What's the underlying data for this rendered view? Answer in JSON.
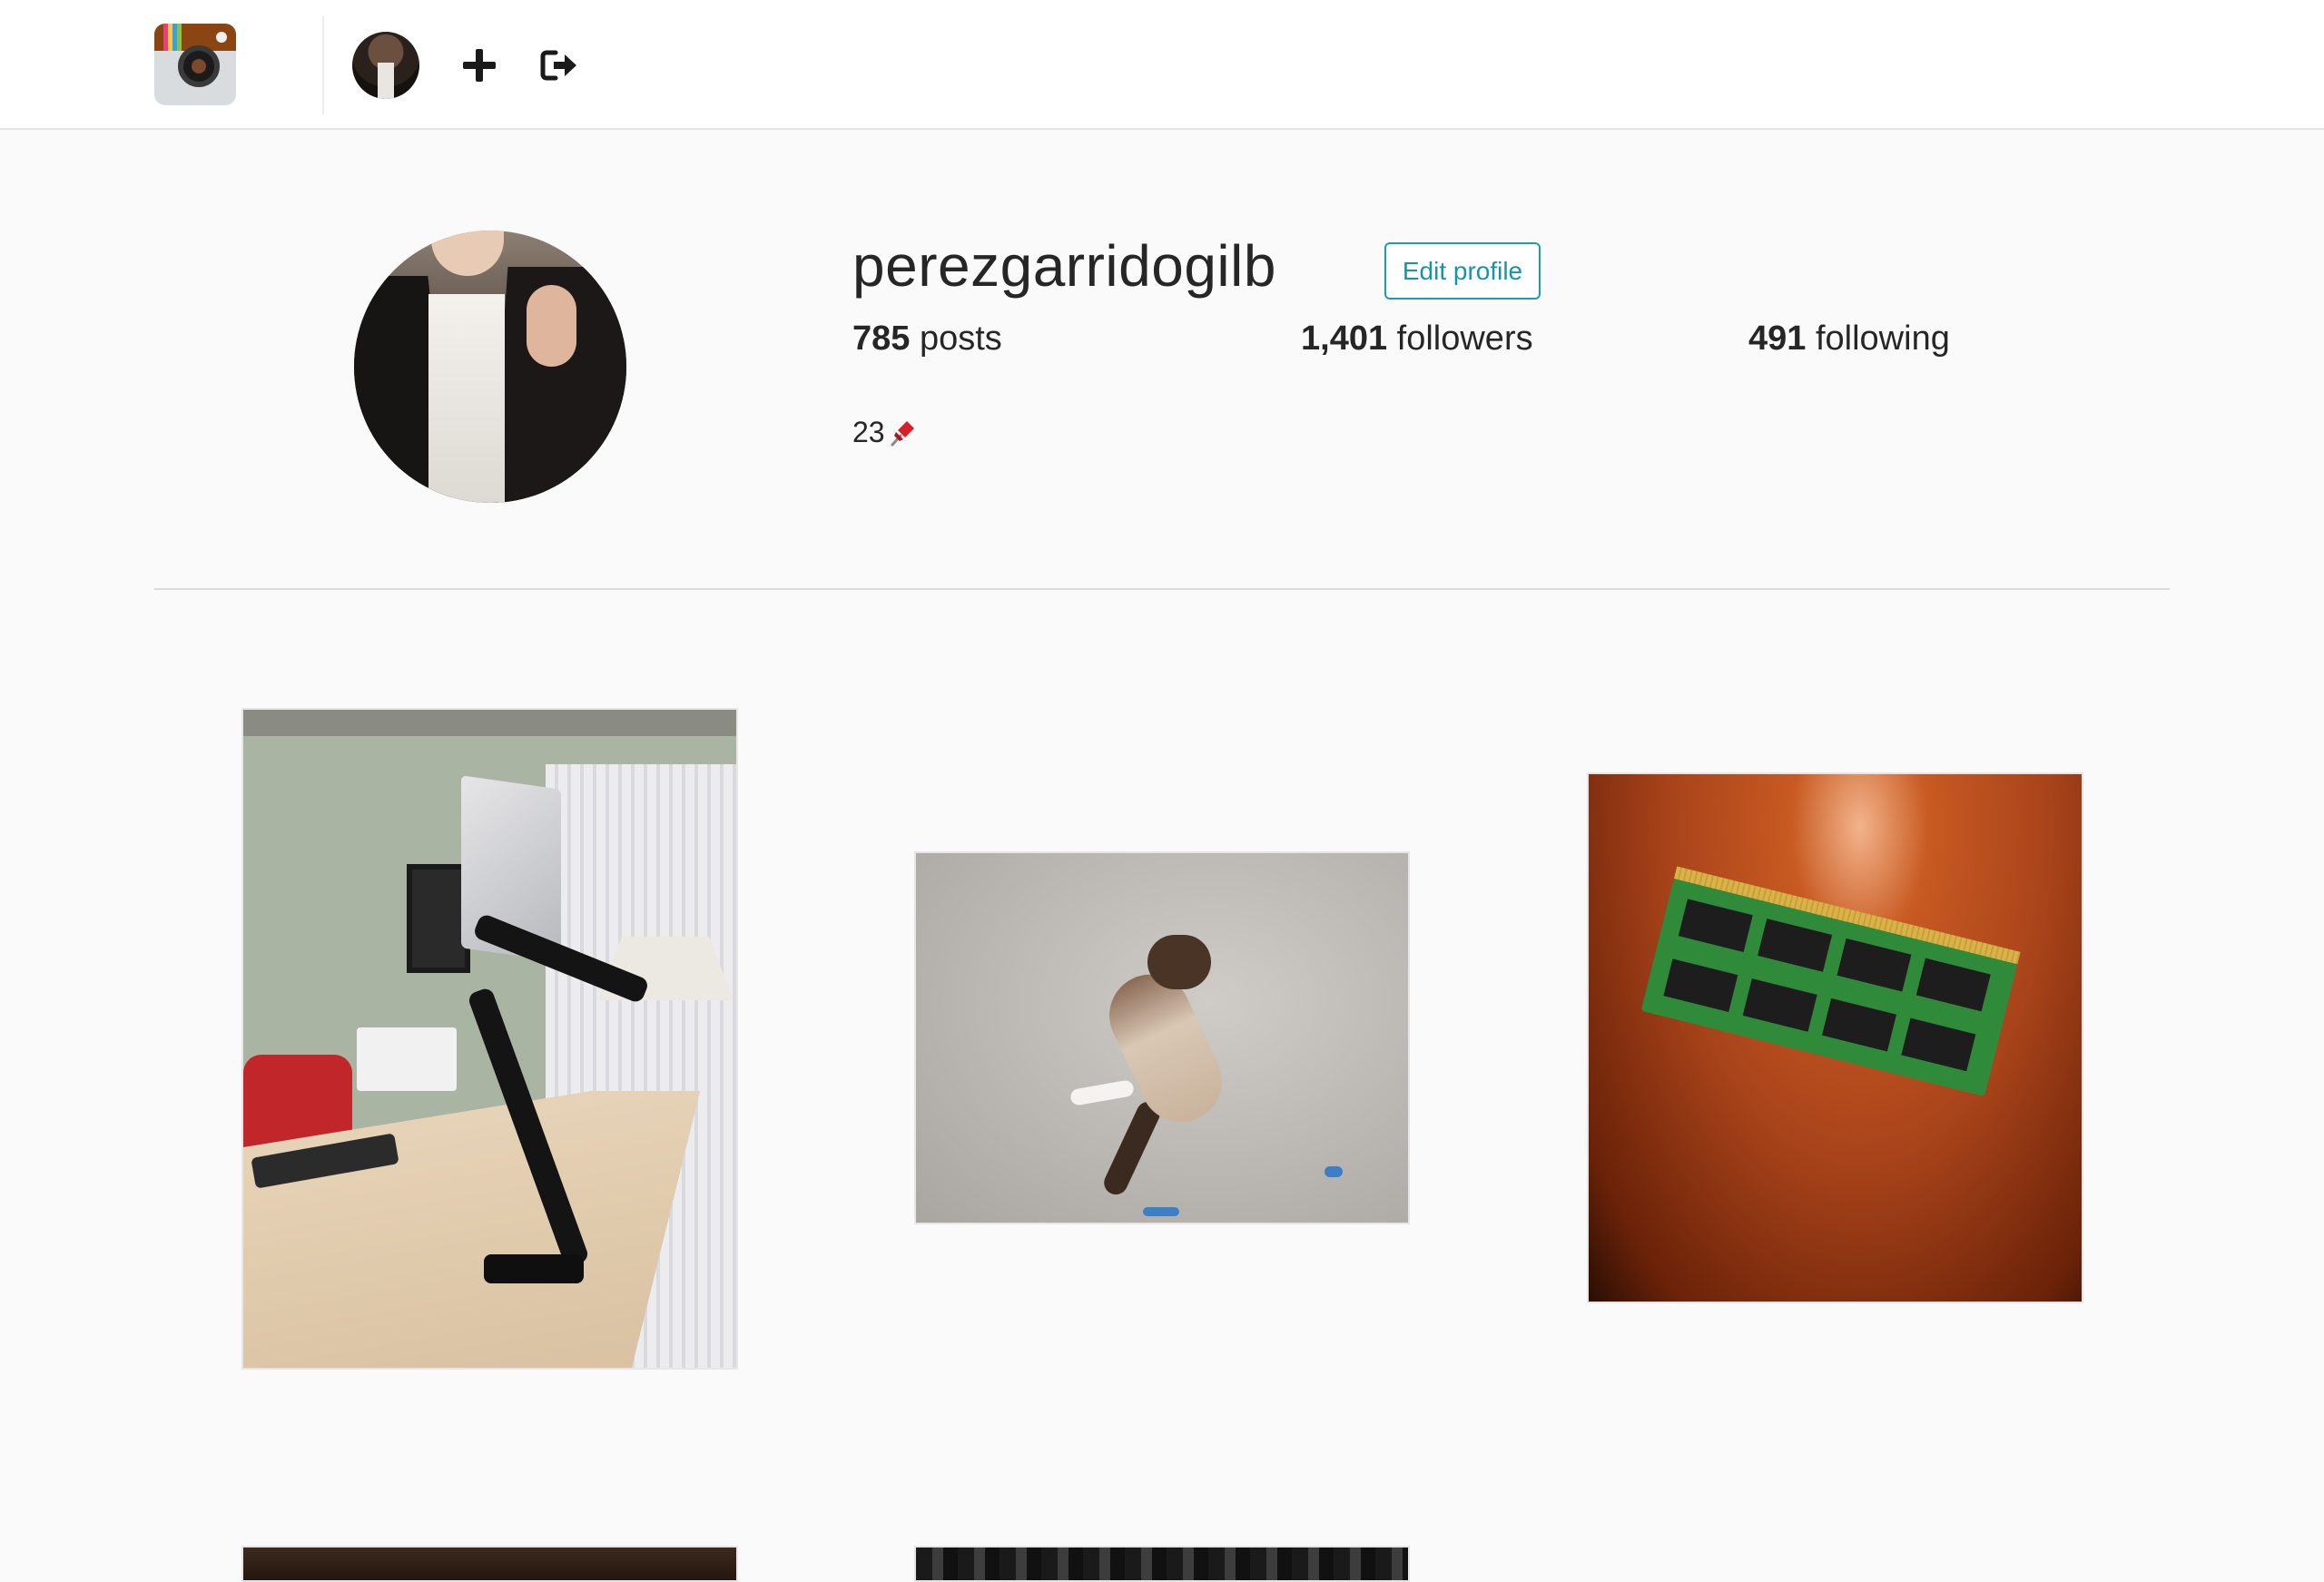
{
  "nav": {
    "logo_icon": "camera-logo-icon",
    "add_icon": "plus-icon",
    "logout_icon": "sign-out-icon"
  },
  "profile": {
    "username": "perezgarridogilb",
    "edit_button": "Edit profile",
    "stats": {
      "posts_count": "785",
      "posts_label": "posts",
      "followers_count": "1,401",
      "followers_label": "followers",
      "following_count": "491",
      "following_label": "following"
    },
    "bio": "23",
    "bio_icon": "pushpin-icon"
  },
  "colors": {
    "accent": "#1693ad",
    "background": "#fafafa",
    "text": "#262626"
  }
}
